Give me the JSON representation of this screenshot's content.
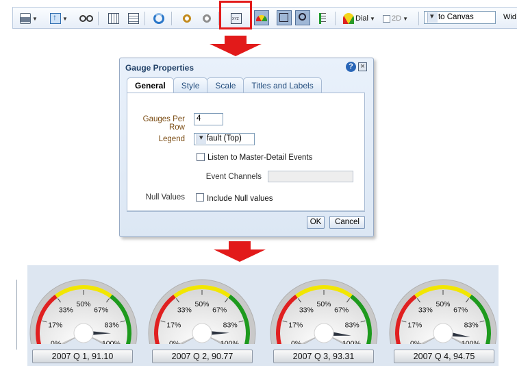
{
  "toolbar": {
    "items": [
      "print-icon",
      "export-icon",
      "binoculars-icon",
      "grid-icon",
      "table-icon",
      "refresh-icon",
      "gear-icon",
      "gear-settings-icon",
      "xyz-properties-icon",
      "dial-type-icon",
      "select-icon",
      "zoom-icon",
      "sort-icon"
    ],
    "dial_label": "Dial",
    "dim_label": "2D",
    "fit_select": "Fit to Canvas",
    "more_label": "Wid"
  },
  "dialog": {
    "title": "Gauge Properties",
    "tabs": [
      "General",
      "Style",
      "Scale",
      "Titles and Labels"
    ],
    "active_tab": "General",
    "fields": {
      "gauges_per_row_label": "Gauges Per Row",
      "gauges_per_row_value": "4",
      "legend_label": "Legend",
      "legend_value": "Default (Top)",
      "listen_label": "Listen to Master-Detail Events",
      "event_channels_label": "Event Channels",
      "null_values_label": "Null Values",
      "include_null_label": "Include Null values"
    },
    "ok_label": "OK",
    "cancel_label": "Cancel"
  },
  "gauges": {
    "tick_labels": [
      "0%",
      "17%",
      "33%",
      "50%",
      "67%",
      "83%",
      "100%"
    ],
    "colors": {
      "low": "#e02020",
      "mid": "#f2e600",
      "high": "#1e9a1e"
    },
    "items": [
      {
        "caption": "2007 Q 1, 91.10",
        "value": 0.911
      },
      {
        "caption": "2007 Q 2, 90.77",
        "value": 0.9077
      },
      {
        "caption": "2007 Q 3, 93.31",
        "value": 0.9331
      },
      {
        "caption": "2007 Q 4, 94.75",
        "value": 0.9475
      }
    ]
  }
}
